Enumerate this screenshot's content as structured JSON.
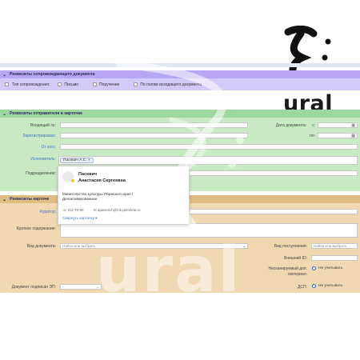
{
  "sections": {
    "accompanying": {
      "title": "Реквизиты сопровождающего документа",
      "type_label": "Тип сопровождения:",
      "options": [
        "Письмо",
        "Поручение",
        "По полям исходящего документа"
      ]
    },
    "sender": {
      "title": "Реквизиты отправителя в карточке",
      "incoming_no_label": "Входящий №:",
      "registered_label": "Зарегистрировал:",
      "from_label": "От кого:",
      "executor_label": "Исполнитель:",
      "department_label": "Подразделение:",
      "doc_date_label": "Дата документа:",
      "date_from_label": "с:",
      "date_to_label": "по:",
      "executor_chip": "Пасевич А.С. ×"
    },
    "card": {
      "title": "Реквизиты карточк",
      "curator_label": "Куратор:",
      "summary_label": "Краткое содержание:",
      "doc_type_label": "Вид документа:",
      "doc_type_placeholder": "Найти или выбрать",
      "signed_label": "Документ подписан ЭП:",
      "signed_value": "-",
      "receipt_label": "Вид поступления:",
      "receipt_placeholder": "Найти или выбрать",
      "ext_id_label": "Внешний ID:",
      "scan_label_1": "Несканируемый доп.",
      "scan_label_2": "материал:",
      "scan_option": "Не учитывать",
      "dsp_label": "ДСП:",
      "dsp_option": "Не учитывать"
    }
  },
  "popup": {
    "surname": "Пасевич",
    "given": "Анастасия Сергеевна",
    "org_line1": "Министерство культуры Пермского края /",
    "org_line2": "Делактивированные",
    "phone": "☏ 211-70-80",
    "email": "✉ apasevich@mk.permkrai.ru",
    "collapse": "Свернуть карточку ▾"
  },
  "logo": {
    "wordmark": "ural",
    "watermark": "ural"
  },
  "colors": {
    "section_purple": "#b9a6f2",
    "section_green": "#9ed79e",
    "section_orange": "#e0bd82",
    "link_blue": "#3f6fc4"
  }
}
